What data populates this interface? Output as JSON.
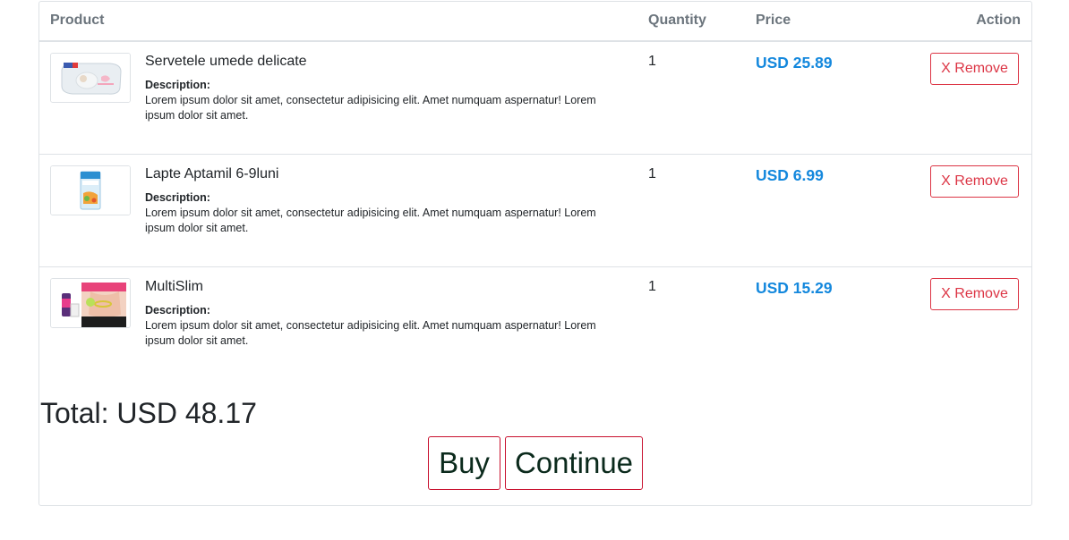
{
  "table": {
    "headers": {
      "product": "Product",
      "quantity": "Quantity",
      "price": "Price",
      "action": "Action"
    },
    "rows": [
      {
        "name": "Servetele umede delicate",
        "description_label": "Description:",
        "description": "Lorem ipsum dolor sit amet, consectetur adipisicing elit. Amet numquam aspernatur! Lorem ipsum dolor sit amet.",
        "quantity": "1",
        "price": "USD 25.89",
        "remove_label": "X Remove",
        "image_icon": "wet-wipes-pack-image"
      },
      {
        "name": "Lapte Aptamil 6-9luni",
        "description_label": "Description:",
        "description": "Lorem ipsum dolor sit amet, consectetur adipisicing elit. Amet numquam aspernatur! Lorem ipsum dolor sit amet.",
        "quantity": "1",
        "price": "USD 6.99",
        "remove_label": "X Remove",
        "image_icon": "milk-formula-box-image"
      },
      {
        "name": "MultiSlim",
        "description_label": "Description:",
        "description": "Lorem ipsum dolor sit amet, consectetur adipisicing elit. Amet numquam aspernatur! Lorem ipsum dolor sit amet.",
        "quantity": "1",
        "price": "USD 15.29",
        "remove_label": "X Remove",
        "image_icon": "slimming-product-image"
      }
    ]
  },
  "summary": {
    "total": "Total: USD 48.17"
  },
  "actions": {
    "buy_label": "Buy",
    "continue_label": "Continue"
  },
  "colors": {
    "price": "#1488dd",
    "remove": "#dc3545",
    "action_border": "#c8102e",
    "header_text": "#6c757d"
  }
}
